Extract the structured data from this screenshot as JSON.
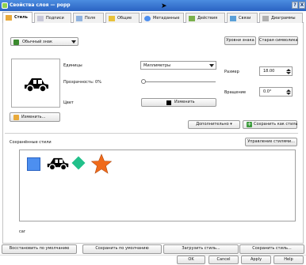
{
  "window": {
    "title": "Свойства слоя — рорр",
    "help_label": "?",
    "close_label": "X"
  },
  "tabs": [
    {
      "label": "Стиль",
      "color": "#e8a93a"
    },
    {
      "label": "Подписи",
      "color": "#c7c7d8"
    },
    {
      "label": "Поля",
      "color": "#8fb3e0"
    },
    {
      "label": "Общие",
      "color": "#e8c23a"
    },
    {
      "label": "Метаданные",
      "color": "#4d8ff0"
    },
    {
      "label": "Действия",
      "color": "#7ab04b"
    },
    {
      "label": "Связи",
      "color": "#5aa0d8"
    },
    {
      "label": "Диаграммы",
      "color": "#b0b0b0"
    }
  ],
  "style": {
    "symbol_type": "Обычный знак",
    "level_button": "Уровни знака",
    "old_symbology_button": "Старая символика",
    "units_label": "Единицы",
    "units_value": "Миллиметры",
    "transparency_label": "Прозрачность: 0%",
    "transparency_value": 0,
    "color_label": "Цвет",
    "color_button": "Изменить",
    "size_label": "Размер",
    "size_value": "18.00",
    "rotation_label": "Вращение",
    "rotation_value": "0.0°",
    "change_button": "Изменить...",
    "more_button": "Дополнительно ▾",
    "save_style_button": "Сохранить как стиль",
    "saved_styles_label": "Сохранённые стили",
    "manage_styles_button": "Управление стилями...",
    "saved_symbols": [
      {
        "icon": "square-icon",
        "color": "#4d8ff0"
      },
      {
        "icon": "car-icon",
        "color": "#000000"
      },
      {
        "icon": "diamond-icon",
        "color": "#21c08a"
      },
      {
        "icon": "star-icon",
        "color": "#f06a1a"
      }
    ],
    "filter_text": "car"
  },
  "footer": {
    "restore_default": "Восстановить по умолчанию",
    "save_default": "Сохранить по умолчанию",
    "load_style": "Загрузить стиль...",
    "save_style": "Сохранить стиль...",
    "ok": "OK",
    "cancel": "Cancel",
    "apply": "Apply",
    "help": "Help"
  }
}
